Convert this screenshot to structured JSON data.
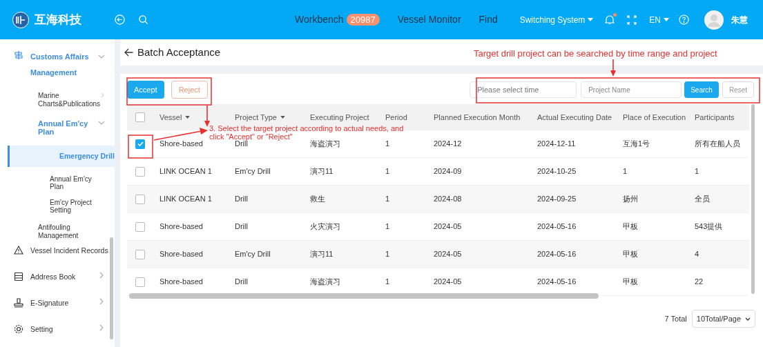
{
  "topbar": {
    "brand": "互海科技",
    "nav": [
      {
        "label": "Workbench",
        "badge": "20987"
      },
      {
        "label": "Vessel Monitor"
      },
      {
        "label": "Find"
      }
    ],
    "system_menu": "Switching System",
    "notification_dot": true,
    "language": "EN",
    "user": "朱慧"
  },
  "sidebar": {
    "items": [
      {
        "label": "Customs Affairs Management",
        "expanded": true,
        "selected": false,
        "children": [
          {
            "label": "Marine Charts&Publications",
            "expanded": false,
            "selected": false
          },
          {
            "label": "Annual Em'cy Plan",
            "expanded": true,
            "selected": false,
            "children": [
              {
                "label": "Emergency Drill",
                "selected": true
              },
              {
                "label": "Annual Em'cy Plan",
                "selected": false
              },
              {
                "label": "Em'cy Project Setting",
                "selected": false
              }
            ]
          },
          {
            "label": "Antifouling Management",
            "selected": false
          }
        ]
      },
      {
        "label": "Vessel Incident Records",
        "selected": false
      },
      {
        "label": "Address Book",
        "expanded": false,
        "selected": false
      },
      {
        "label": "E-Signature",
        "expanded": false,
        "selected": false
      },
      {
        "label": "Setting",
        "expanded": false,
        "selected": false
      }
    ]
  },
  "page": {
    "title": "Batch Acceptance",
    "actions": [
      "Accept",
      "Reject"
    ],
    "time_field": {
      "placeholder": "Please select time"
    },
    "name_field": {
      "placeholder": "Project Name"
    },
    "search_button": "Search",
    "reset_button": "Reset"
  },
  "table": {
    "columns": [
      "Vessel",
      "Project Type",
      "Executing Project",
      "Period",
      "Planned Execution Month",
      "Actual Executing Date",
      "Place of Execution",
      "Participants"
    ],
    "sortable": [
      true,
      true,
      false,
      false,
      false,
      false,
      false,
      false
    ],
    "all_checked": false,
    "rows": [
      {
        "checked": true,
        "cells": [
          "Shore-based",
          "Drill",
          "海盗演习",
          "1",
          "2024-12",
          "2024-12-11",
          "互海1号",
          "所有在船人员"
        ]
      },
      {
        "checked": false,
        "cells": [
          "LINK OCEAN 1",
          "Em'cy Drill",
          "演习11",
          "1",
          "2024-09",
          "2024-10-25",
          "1",
          "1"
        ]
      },
      {
        "checked": false,
        "cells": [
          "LINK OCEAN 1",
          "Drill",
          "救生",
          "1",
          "2024-08",
          "2024-09-25",
          "扬州",
          "全员"
        ]
      },
      {
        "checked": false,
        "cells": [
          "Shore-based",
          "Drill",
          "火灾演习",
          "1",
          "2024-05",
          "2024-05-16",
          "甲板",
          "543提供"
        ]
      },
      {
        "checked": false,
        "cells": [
          "Shore-based",
          "Em'cy Drill",
          "演习11",
          "1",
          "2024-05",
          "2024-05-16",
          "甲板",
          "4"
        ]
      },
      {
        "checked": false,
        "cells": [
          "Shore-based",
          "Drill",
          "海盗演习",
          "1",
          "2024-05",
          "2024-05-16",
          "甲板",
          "22"
        ]
      }
    ]
  },
  "pagination": {
    "total": "7 Total",
    "page_size": "10Total/Page"
  },
  "annotations": [
    "Target drill project can be searched by time range and project",
    "3. Select the target project according to actual needs, and click \"Accept\" or \"Reject\""
  ]
}
